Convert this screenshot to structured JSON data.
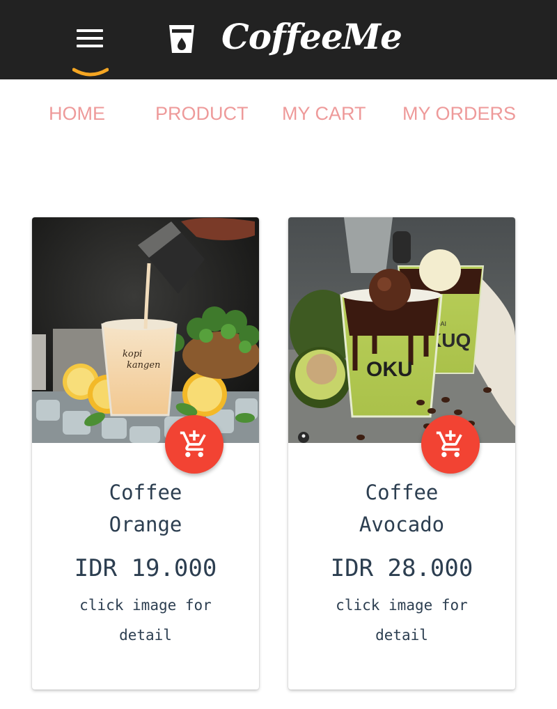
{
  "header": {
    "brand": "CoffeeMe",
    "menu_icon": "hamburger-menu-icon",
    "logo_icon": "coffee-cup-icon",
    "accent_color": "#f5a623",
    "background_color": "#222222"
  },
  "nav": {
    "items": [
      {
        "label": "HOME"
      },
      {
        "label": "PRODUCT"
      },
      {
        "label": "MY CART"
      },
      {
        "label": "MY ORDERS"
      }
    ],
    "color": "#ee9a9a"
  },
  "products": [
    {
      "name": "Coffee Orange",
      "price": "IDR 19.000",
      "hint": "click image for detail",
      "image_label": "kopi kangen",
      "cart_icon": "add-to-cart-icon"
    },
    {
      "name": "Coffee Avocado",
      "price": "IDR 28.000",
      "hint": "click image for detail",
      "image_label_front": "OKU",
      "image_label_back": "KEDAI KUQ",
      "cart_icon": "add-to-cart-icon"
    }
  ],
  "colors": {
    "fab": "#f24333",
    "text": "#2c3e50"
  }
}
